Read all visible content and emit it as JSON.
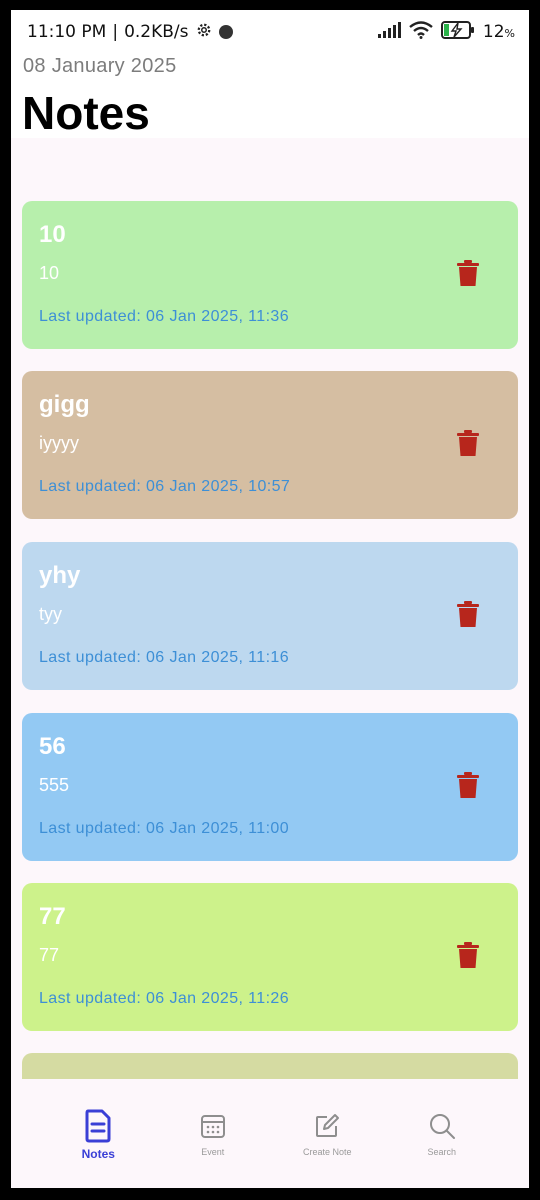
{
  "status_bar": {
    "time": "11:10 PM",
    "separator": "|",
    "speed": "0.2KB/s",
    "battery_percent": "12",
    "battery_percent_sign": "%"
  },
  "header": {
    "date": "08 January 2025",
    "title": "Notes"
  },
  "notes": [
    {
      "title": "10",
      "body": "10",
      "updated": "Last updated: 06 Jan 2025, 11:36",
      "color": "#b7efac"
    },
    {
      "title": "gigg",
      "body": "iyyyy",
      "updated": "Last updated: 06 Jan 2025, 10:57",
      "color": "#d5bea2"
    },
    {
      "title": "yhy",
      "body": "tyy",
      "updated": "Last updated: 06 Jan 2025, 11:16",
      "color": "#bdd8ef"
    },
    {
      "title": "56",
      "body": "555",
      "updated": "Last updated: 06 Jan 2025, 11:00",
      "color": "#93c9f3"
    },
    {
      "title": "77",
      "body": "77",
      "updated": "Last updated: 06 Jan 2025, 11:26",
      "color": "#cdf28b"
    }
  ],
  "partial_card_color": "#d5dba2",
  "bottom_nav": {
    "items": [
      {
        "label": "Notes",
        "icon": "note-document-icon",
        "active": true
      },
      {
        "label": "Event",
        "icon": "calendar-icon",
        "active": false
      },
      {
        "label": "Create Note",
        "icon": "edit-note-icon",
        "active": false
      },
      {
        "label": "Search",
        "icon": "search-icon",
        "active": false
      }
    ]
  },
  "colors": {
    "delete_icon": "#b7261c",
    "updated_text": "#3d8fd6",
    "nav_active": "#3a3fd6",
    "nav_inactive": "#9a9a9a",
    "list_background": "#fdf7fb"
  }
}
